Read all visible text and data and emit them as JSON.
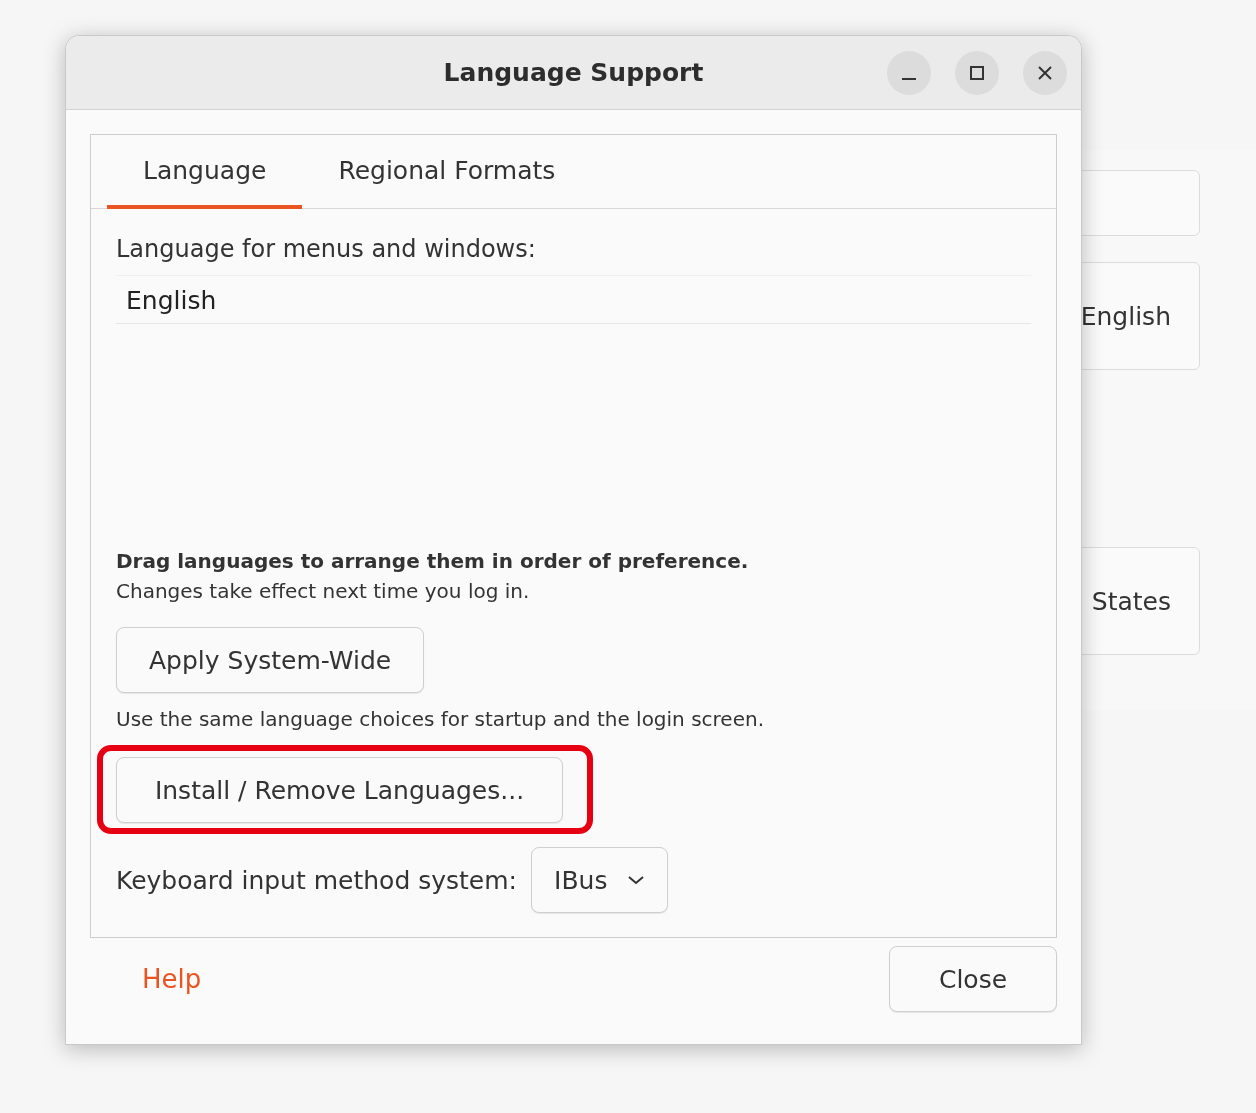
{
  "background_window": {
    "items": [
      "English",
      "States"
    ]
  },
  "window": {
    "title": "Language Support"
  },
  "tabs": [
    {
      "label": "Language",
      "selected": true
    },
    {
      "label": "Regional Formats",
      "selected": false
    }
  ],
  "language_panel": {
    "heading": "Language for menus and windows:",
    "languages": [
      {
        "name": "English"
      }
    ],
    "drag_hint": "Drag languages to arrange them in order of preference.",
    "changes_note": "Changes take effect next time you log in.",
    "apply_button": "Apply System-Wide",
    "apply_note": "Use the same language choices for startup and the login screen.",
    "install_button": {
      "label": "Install / Remove Languages...",
      "highlighted": true
    },
    "keyboard": {
      "label": "Keyboard input method system:",
      "value": "IBus"
    }
  },
  "footer": {
    "help_link": "Help",
    "close_button": "Close"
  }
}
